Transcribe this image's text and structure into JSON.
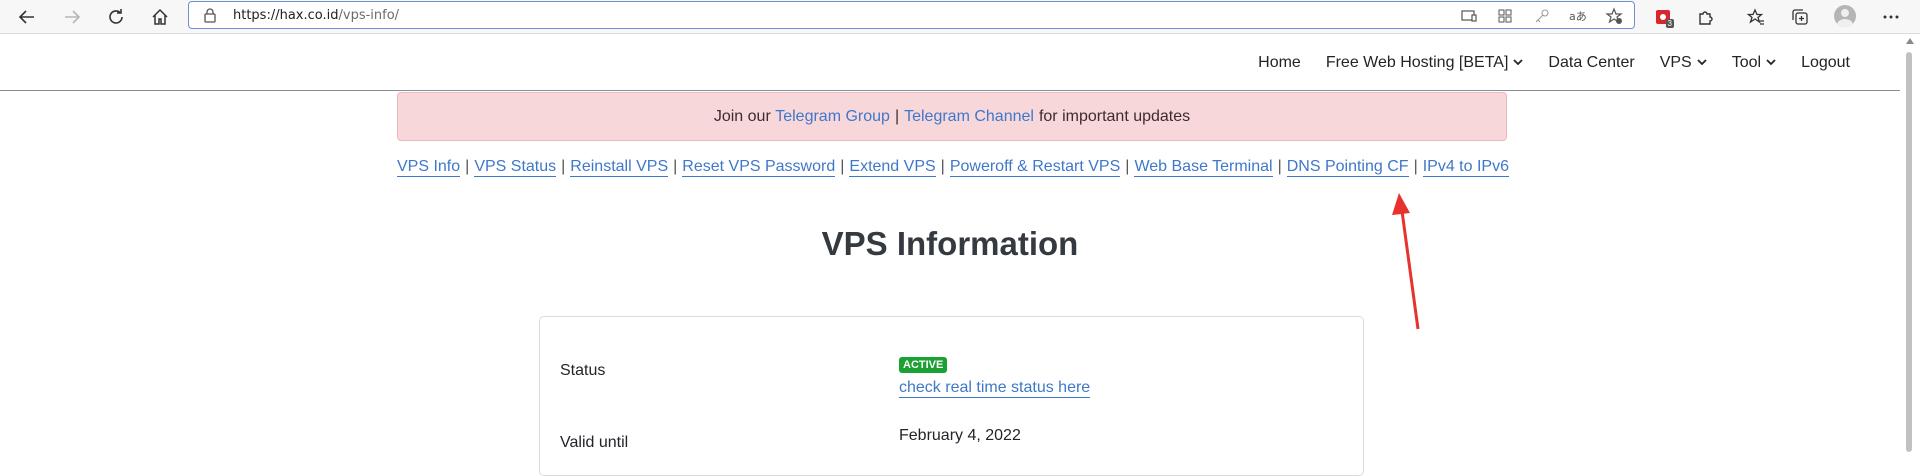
{
  "browser": {
    "url_host": "https://hax.co.id",
    "url_path": "/vps-info/",
    "extension_badge": "3"
  },
  "nav": {
    "home": "Home",
    "free_hosting": "Free Web Hosting [BETA]",
    "data_center": "Data Center",
    "vps": "VPS",
    "tool": "Tool",
    "logout": "Logout"
  },
  "alert": {
    "prefix": "Join our",
    "group_link": "Telegram Group",
    "separator": "|",
    "channel_link": "Telegram Channel",
    "suffix": "for important updates",
    "background": "#f8d7da"
  },
  "subnav": {
    "items": [
      "VPS Info",
      "VPS Status",
      "Reinstall VPS",
      "Reset VPS Password",
      "Extend VPS",
      "Poweroff & Restart VPS",
      "Web Base Terminal",
      "DNS Pointing CF",
      "IPv4 to IPv6"
    ],
    "separator": "|"
  },
  "page": {
    "title": "VPS Information"
  },
  "info": {
    "status_label": "Status",
    "status_badge": "ACTIVE",
    "status_link": "check real time status here",
    "valid_label": "Valid until",
    "valid_value": "February 4, 2022"
  },
  "colors": {
    "link": "#3f78c9",
    "active_badge": "#1aa033",
    "annotation_arrow": "#e8322d"
  },
  "icons": [
    "back-icon",
    "forward-icon",
    "refresh-icon",
    "home-icon",
    "lock-icon",
    "cast-icon",
    "grid-icon",
    "key-icon",
    "translate-icon",
    "star-add-icon",
    "record-icon",
    "puzzle-icon",
    "favorites-icon",
    "collections-icon",
    "profile-icon",
    "more-icon",
    "chevron-down-icon"
  ]
}
